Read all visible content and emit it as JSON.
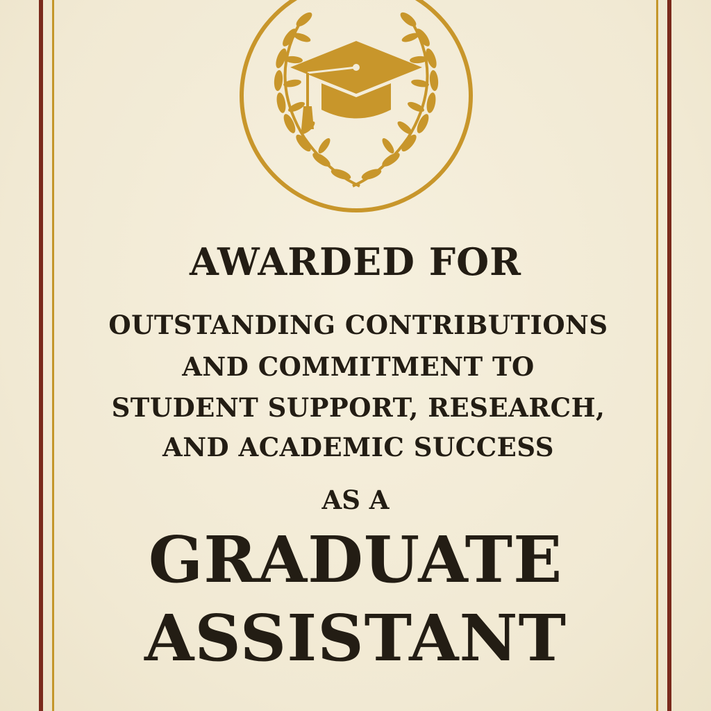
{
  "colors": {
    "paper": "#f3ecd8",
    "maroon_border": "#7a2a1c",
    "gold_border": "#c4962a",
    "emblem_gold": "#c8962b",
    "text": "#231d14"
  },
  "emblem": {
    "icon": "graduation-cap-laurel-seal-icon"
  },
  "certificate": {
    "awarded_for": "AWARDED FOR",
    "reason_lines": [
      "OUTSTANDING CONTRIBUTIONS",
      "AND COMMITMENT TO",
      "STUDENT SUPPORT, RESEARCH,",
      "AND ACADEMIC SUCCESS"
    ],
    "as_a": "AS A",
    "title_lines": [
      "GRADUATE",
      "ASSISTANT"
    ]
  }
}
